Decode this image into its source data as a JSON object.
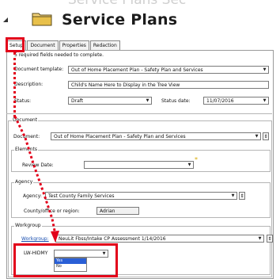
{
  "header": {
    "title": "Service Plans",
    "ghost_title": "Service Plans Sec"
  },
  "tabs": [
    {
      "label": "Setup"
    },
    {
      "label": "Document"
    },
    {
      "label": "Properties"
    },
    {
      "label": "Redaction"
    }
  ],
  "setup": {
    "required_note": "5 required fields needed to complete.",
    "document_template_label": "Document template:",
    "document_template_value": "Out of Home Placement Plan - Safety Plan and Services",
    "description_label": "Description:",
    "description_value": "Child's Name Here to Display in the Tree View",
    "status_label": "Status:",
    "status_value": "Draft",
    "status_date_label": "Status date:",
    "status_date_value": "11/07/2016"
  },
  "document_section": {
    "group_label": "Document",
    "document_label": "Document:",
    "document_value": "Out of Home Placement Plan - Safety Plan and Services"
  },
  "elements_section": {
    "group_label": "Elements",
    "review_date_label": "Review Date:",
    "review_date_value": ""
  },
  "agency_section": {
    "group_label": "Agency",
    "agency_label": "Agency:",
    "agency_value": "Test County Family Services",
    "county_label": "County/office or region:",
    "county_value": "Adrian"
  },
  "workgroup_section": {
    "group_label": "Workgroup",
    "workgroup_label": "Workgroup:",
    "workgroup_value": "NeuLit Fbss/Intake CP Assessment 1/14/2016",
    "lw_label": "LW-HIDMY",
    "lw_value": "",
    "lw_options": [
      "Yes",
      "No"
    ]
  },
  "icons": {
    "folder": "folder-icon",
    "collapse": "collapse-triangle-icon",
    "required_star": "required-star-icon",
    "dropdown": "chevron-down-icon",
    "stepper": "stepper-icon"
  },
  "colors": {
    "highlight": "#e2001a",
    "folder": "#e8c04a",
    "link": "#1a4fb0",
    "selected_option": "#2a5fd6"
  }
}
